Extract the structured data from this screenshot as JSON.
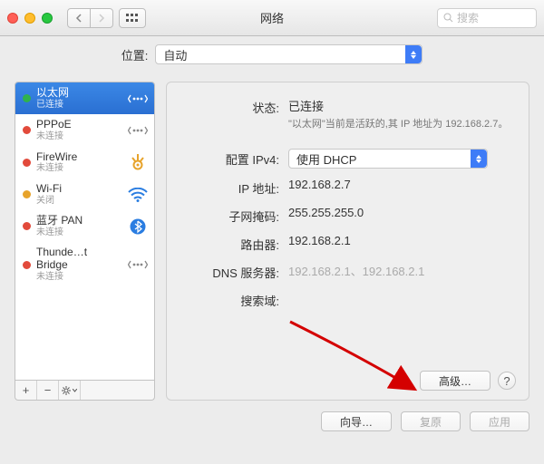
{
  "titlebar": {
    "title": "网络",
    "search_placeholder": "搜索"
  },
  "location": {
    "label": "位置:",
    "value": "自动"
  },
  "services": [
    {
      "name": "以太网",
      "sub": "已连接",
      "status": "green",
      "selected": true,
      "icon": "chevrons"
    },
    {
      "name": "PPPoE",
      "sub": "未连接",
      "status": "red",
      "selected": false,
      "icon": "chevrons"
    },
    {
      "name": "FireWire",
      "sub": "未连接",
      "status": "red",
      "selected": false,
      "icon": "firewire"
    },
    {
      "name": "Wi-Fi",
      "sub": "关闭",
      "status": "orange",
      "selected": false,
      "icon": "wifi"
    },
    {
      "name": "蓝牙 PAN",
      "sub": "未连接",
      "status": "red",
      "selected": false,
      "icon": "bluetooth"
    },
    {
      "name": "Thunde…t Bridge",
      "sub": "未连接",
      "status": "red",
      "selected": false,
      "icon": "chevrons"
    }
  ],
  "detail": {
    "status_label": "状态:",
    "status_value": "已连接",
    "status_note": "\"以太网\"当前是活跃的,其 IP 地址为 192.168.2.7。",
    "config_label": "配置 IPv4:",
    "config_value": "使用 DHCP",
    "ip_label": "IP 地址:",
    "ip_value": "192.168.2.7",
    "mask_label": "子网掩码:",
    "mask_value": "255.255.255.0",
    "router_label": "路由器:",
    "router_value": "192.168.2.1",
    "dns_label": "DNS 服务器:",
    "dns_value": "192.168.2.1、192.168.2.1",
    "search_label": "搜索域:",
    "search_value": "",
    "advanced_btn": "高级…"
  },
  "footer": {
    "assistant": "向导…",
    "revert": "复原",
    "apply": "应用"
  }
}
